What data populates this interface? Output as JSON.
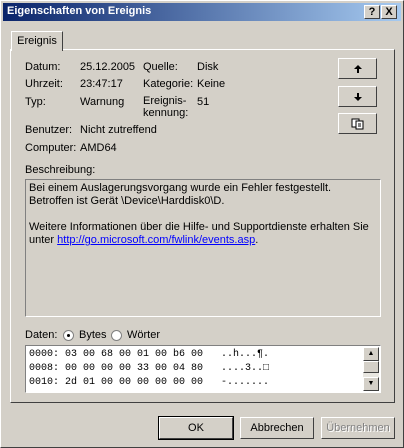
{
  "window": {
    "title": "Eigenschaften von Ereignis"
  },
  "titlebar": {
    "help_label": "?",
    "close_label": "X"
  },
  "tabs": [
    {
      "label": "Ereignis"
    }
  ],
  "event": {
    "datum_label": "Datum:",
    "datum": "25.12.2005",
    "uhrzeit_label": "Uhrzeit:",
    "uhrzeit": "23:47:17",
    "typ_label": "Typ:",
    "typ": "Warnung",
    "quelle_label": "Quelle:",
    "quelle": "Disk",
    "kategorie_label": "Kategorie:",
    "kategorie": "Keine",
    "kennung_label_1": "Ereignis-",
    "kennung_label_2": "kennung:",
    "kennung": "51",
    "benutzer_label": "Benutzer:",
    "benutzer": "Nicht zutreffend",
    "computer_label": "Computer:",
    "computer": "AMD64"
  },
  "side_buttons": {
    "up_icon": "arrow-up-icon",
    "down_icon": "arrow-down-icon",
    "copy_icon": "copy-icon"
  },
  "beschreibung": {
    "label": "Beschreibung:",
    "line1": "Bei einem Auslagerungsvorgang wurde ein Fehler festgestellt. Betroffen ist Gerät \\Device\\Harddisk0\\D.",
    "line2_prefix": "Weitere Informationen über die Hilfe- und Supportdienste erhalten Sie unter ",
    "link": "http://go.microsoft.com/fwlink/events.asp",
    "suffix": "."
  },
  "daten": {
    "label": "Daten:",
    "radio_bytes": "Bytes",
    "radio_woerter": "Wörter",
    "selected": "Bytes",
    "rows": [
      "0000: 03 00 68 00 01 00 b6 00   ..h...¶.",
      "0008: 00 00 00 00 33 00 04 80   ....3..□",
      "0010: 2d 01 00 00 00 00 00 00   -......."
    ]
  },
  "buttons": {
    "ok": "OK",
    "cancel": "Abbrechen",
    "apply": "Übernehmen"
  }
}
